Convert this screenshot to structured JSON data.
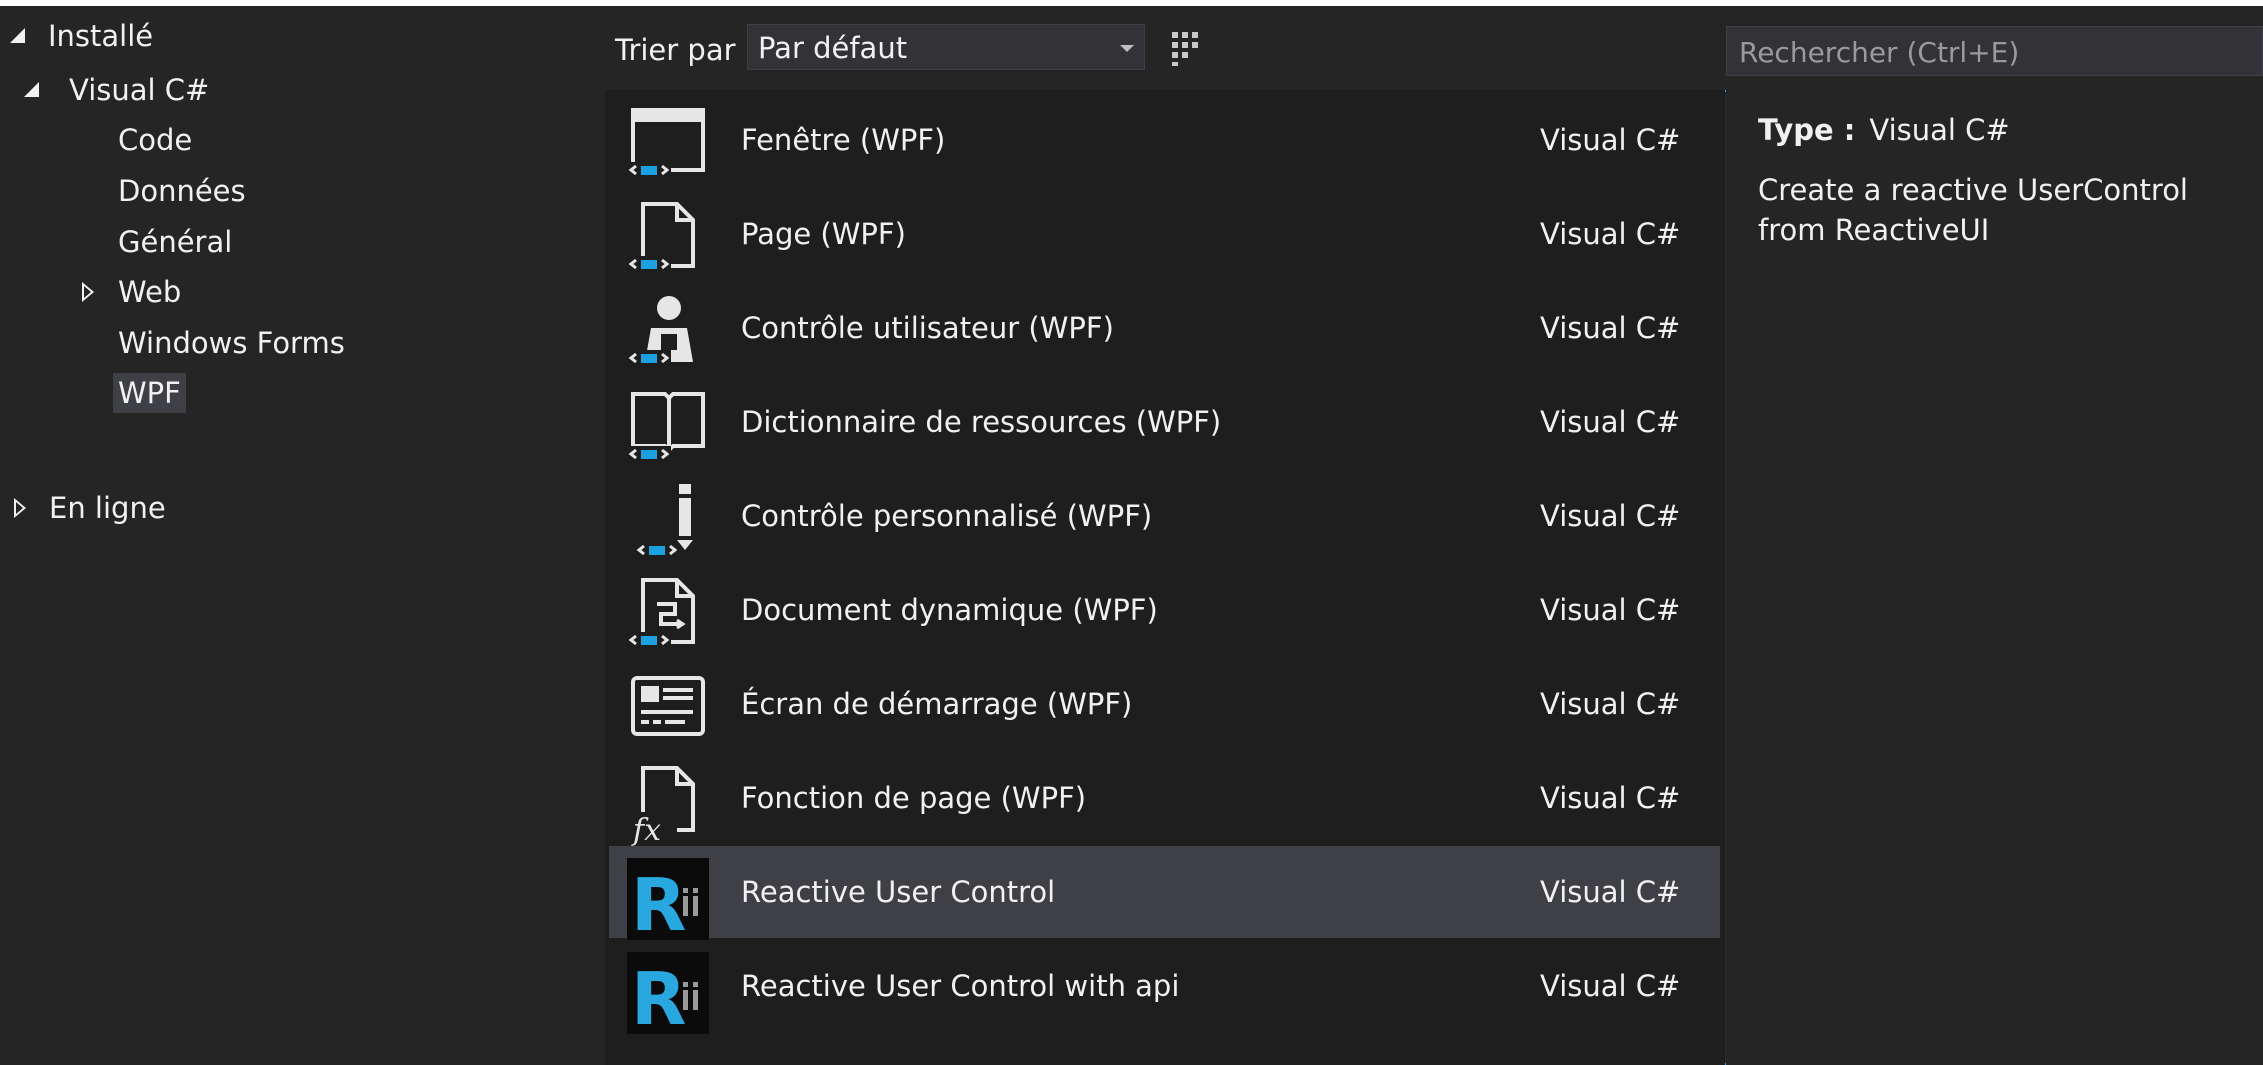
{
  "tree": {
    "installed": "Installé",
    "visual_csharp": "Visual C#",
    "children": [
      "Code",
      "Données",
      "Général",
      "Web",
      "Windows Forms",
      "WPF"
    ],
    "selected": "WPF",
    "online": "En ligne"
  },
  "toolbar": {
    "sort_label": "Trier par :",
    "sort_value": "Par défaut",
    "view_small_icon": "small-icons-view-icon",
    "view_list_icon": "list-view-icon"
  },
  "search": {
    "placeholder": "Rechercher (Ctrl+E)"
  },
  "templates": [
    {
      "name": "Fenêtre (WPF)",
      "lang": "Visual C#",
      "icon": "wpf-window-icon"
    },
    {
      "name": "Page (WPF)",
      "lang": "Visual C#",
      "icon": "wpf-page-icon"
    },
    {
      "name": "Contrôle utilisateur (WPF)",
      "lang": "Visual C#",
      "icon": "wpf-user-control-icon"
    },
    {
      "name": "Dictionnaire de ressources (WPF)",
      "lang": "Visual C#",
      "icon": "wpf-resource-dictionary-icon"
    },
    {
      "name": "Contrôle personnalisé (WPF)",
      "lang": "Visual C#",
      "icon": "wpf-custom-control-icon"
    },
    {
      "name": "Document dynamique (WPF)",
      "lang": "Visual C#",
      "icon": "wpf-flow-document-icon"
    },
    {
      "name": "Écran de démarrage (WPF)",
      "lang": "Visual C#",
      "icon": "wpf-splash-screen-icon"
    },
    {
      "name": "Fonction de page (WPF)",
      "lang": "Visual C#",
      "icon": "wpf-page-function-icon"
    },
    {
      "name": "Reactive User Control",
      "lang": "Visual C#",
      "icon": "reactiveui-logo-icon"
    },
    {
      "name": "Reactive User Control with api",
      "lang": "Visual C#",
      "icon": "reactiveui-logo-icon"
    }
  ],
  "selected_template": "Reactive User Control",
  "details": {
    "type_label": "Type :",
    "type_value": "Visual C#",
    "description": "Create a reactive UserControl from ReactiveUI"
  },
  "colors": {
    "background": "#252526",
    "list_background": "#1e1e1e",
    "selection": "#3f3f46",
    "accent": "#3399ff",
    "wpf_icon_blue": "#1ba1e2",
    "reactiveui_blue": "#29a8e0"
  }
}
